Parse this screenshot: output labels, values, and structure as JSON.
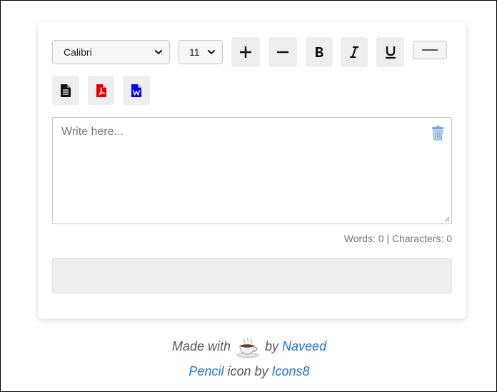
{
  "toolbar": {
    "font_value": "Calibri",
    "size_value": "11",
    "icons": {
      "increase": "plus-icon",
      "decrease": "minus-icon",
      "bold": "bold-icon",
      "italic": "italic-icon",
      "underline": "underline-icon",
      "rule": "horizontal-line-icon",
      "txt": "text-document-icon",
      "pdf": "pdf-icon",
      "word": "word-icon"
    },
    "colors": {
      "pdf": "#e00000",
      "word": "#0000ee"
    }
  },
  "editor": {
    "placeholder": "Write here...",
    "trash_icon": "trash-icon"
  },
  "stats": {
    "words_label": "Words:",
    "words": "0",
    "separator": "|",
    "chars_label": "Characters:",
    "characters": "0"
  },
  "footer": {
    "made_with": "Made with",
    "cup_icon": "coffee-cup-icon",
    "by": "by",
    "author": "Naveed",
    "pencil": "Pencil",
    "icon_by": "icon by",
    "icons_source": "Icons8",
    "link_color": "#1a73e8"
  }
}
